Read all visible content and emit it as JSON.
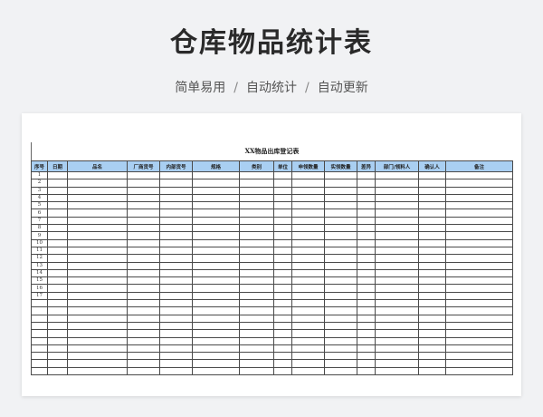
{
  "page": {
    "title": "仓库物品统计表",
    "tags": [
      "简单易用",
      "自动统计",
      "自动更新"
    ],
    "separator": "/"
  },
  "sheet": {
    "table_title": "XX物品出库登记表",
    "columns": [
      "序号",
      "日期",
      "品名",
      "厂商货号",
      "内部货号",
      "规格",
      "类别",
      "单位",
      "申领数量",
      "实领数量",
      "差异",
      "部门/领料人",
      "确认人",
      "备注"
    ],
    "row_numbers": [
      "1",
      "2",
      "3",
      "4",
      "5",
      "6",
      "7",
      "8",
      "9",
      "10",
      "11",
      "12",
      "13",
      "14",
      "15",
      "16",
      "17",
      "",
      "",
      "",
      "",
      "",
      "",
      "",
      "",
      "",
      ""
    ]
  }
}
